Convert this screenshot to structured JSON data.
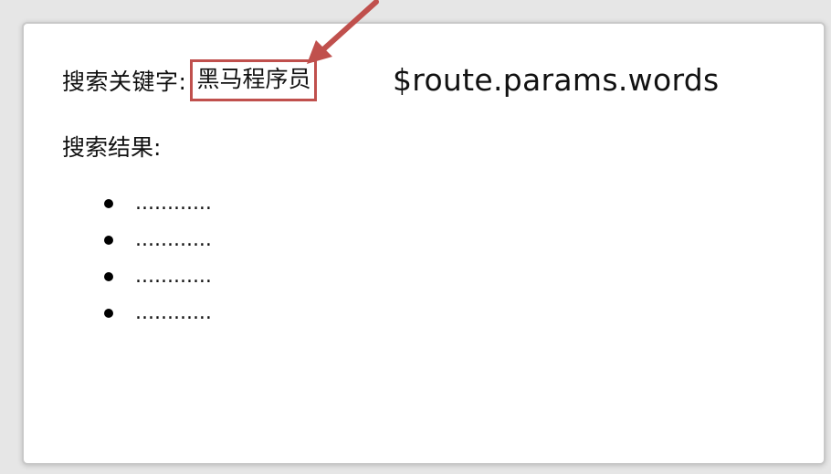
{
  "search": {
    "keyword_label": "搜索关键字:",
    "keyword_value": "黑马程序员",
    "route_expression": "$route.params.words",
    "result_label": "搜索结果:",
    "results": [
      "............",
      "............",
      "............",
      "............"
    ]
  },
  "colors": {
    "highlight": "#c0504d",
    "arrow": "#c0504d"
  },
  "icons": {
    "annotation_arrow": "arrow-icon",
    "list_bullet": "bullet-icon"
  }
}
